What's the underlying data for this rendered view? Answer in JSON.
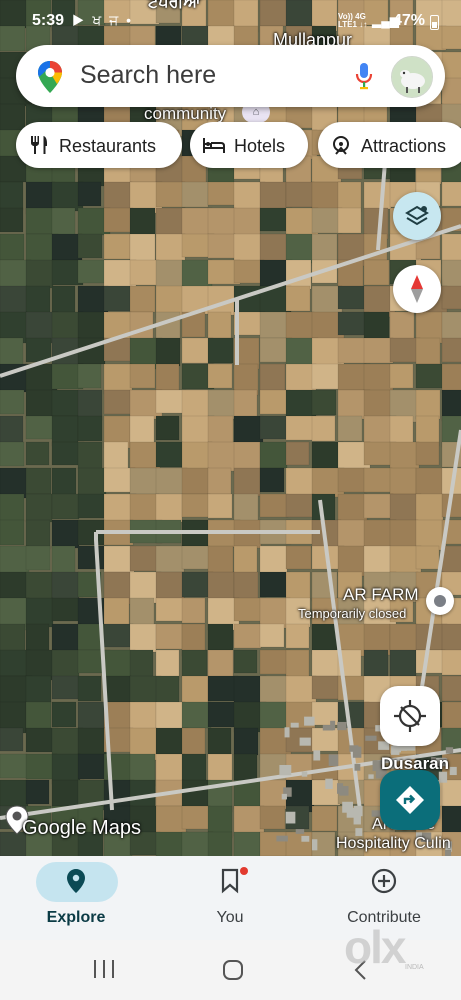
{
  "status_bar": {
    "time": "5:39",
    "notification_icons": "▶ ਖ ਜ •",
    "network": [
      "Vo)) 4G",
      "LTE1 ↓↑"
    ],
    "battery": "47%"
  },
  "map": {
    "labels": {
      "top_punjabi": "ਟਪਰੀਆ",
      "mullanpur": "Mullanpur",
      "community": "community",
      "ar_farm": "AR FARM",
      "ar_farm_status": "Temporarily closed",
      "dusaran": "Dusaran",
      "ar_college": "AR Colle",
      "hospitality": "Hospitality Culin"
    },
    "brand": "Google Maps",
    "colors": {
      "layers_button": "#c7e7f0",
      "directions_button": "#0b6e7a",
      "explore_pill": "#c5e4ef"
    }
  },
  "search": {
    "placeholder": "Search here"
  },
  "chips": [
    {
      "label": "Restaurants",
      "icon": "fork-knife-icon"
    },
    {
      "label": "Hotels",
      "icon": "bed-icon"
    },
    {
      "label": "Attractions",
      "icon": "attractions-icon"
    }
  ],
  "nav": {
    "explore": "Explore",
    "you": "You",
    "contribute": "Contribute"
  },
  "watermark": {
    "olx": "olx",
    "sub": "INDIA"
  }
}
